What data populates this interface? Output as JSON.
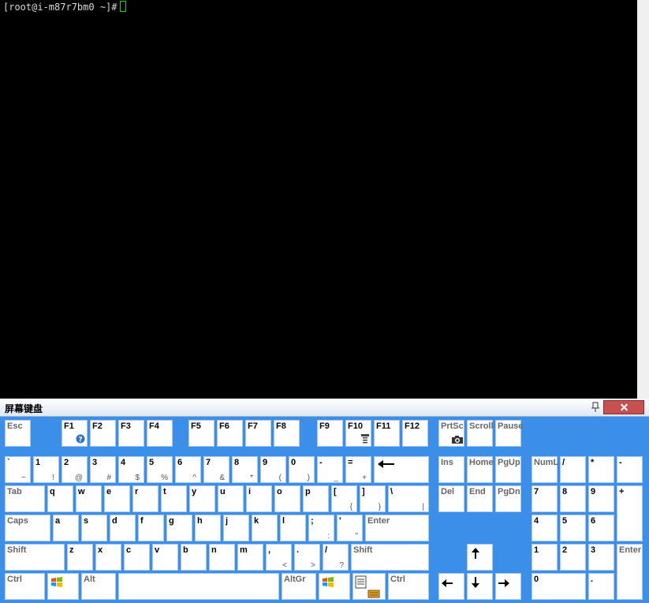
{
  "terminal": {
    "prompt": "[root@i-m87r7bm0 ~]#"
  },
  "osk": {
    "title": "屏幕键盘",
    "icons": {
      "pin": "pin-icon",
      "close": "close-icon"
    },
    "keys": [
      {
        "n": "esc",
        "p": "Esc",
        "d": 1
      },
      {
        "n": "f1",
        "p": "F1",
        "icon": "help-icon"
      },
      {
        "n": "f2",
        "p": "F2"
      },
      {
        "n": "f3",
        "p": "F3"
      },
      {
        "n": "f4",
        "p": "F4"
      },
      {
        "n": "f5",
        "p": "F5"
      },
      {
        "n": "f6",
        "p": "F6"
      },
      {
        "n": "f7",
        "p": "F7"
      },
      {
        "n": "f8",
        "p": "F8"
      },
      {
        "n": "f9",
        "p": "F9"
      },
      {
        "n": "f10",
        "p": "F10",
        "icon": "menu-icon"
      },
      {
        "n": "f11",
        "p": "F11"
      },
      {
        "n": "f12",
        "p": "F12"
      },
      {
        "n": "prtsc",
        "p": "PrtSc",
        "icon": "camera-icon",
        "d": 1
      },
      {
        "n": "scroll",
        "p": "Scroll",
        "d": 1
      },
      {
        "n": "pause",
        "p": "Pause",
        "d": 1
      },
      {
        "n": "backtick",
        "p": "`",
        "s": "~"
      },
      {
        "n": "1",
        "p": "1",
        "s": "!"
      },
      {
        "n": "2",
        "p": "2",
        "s": "@"
      },
      {
        "n": "3",
        "p": "3",
        "s": "#"
      },
      {
        "n": "4",
        "p": "4",
        "s": "$"
      },
      {
        "n": "5",
        "p": "5",
        "s": "%"
      },
      {
        "n": "6",
        "p": "6",
        "s": "^"
      },
      {
        "n": "7",
        "p": "7",
        "s": "&"
      },
      {
        "n": "8",
        "p": "8",
        "s": "*"
      },
      {
        "n": "9",
        "p": "9",
        "s": "("
      },
      {
        "n": "0",
        "p": "0",
        "s": ")"
      },
      {
        "n": "minus",
        "p": "-",
        "s": "_"
      },
      {
        "n": "equals",
        "p": "=",
        "s": "+"
      },
      {
        "n": "backspace",
        "icon": "backspace-arrow-icon"
      },
      {
        "n": "ins",
        "p": "Ins",
        "d": 1
      },
      {
        "n": "home",
        "p": "Home",
        "d": 1
      },
      {
        "n": "pgup",
        "p": "PgUp",
        "d": 1
      },
      {
        "n": "numlock",
        "p": "NumL",
        "d": 1
      },
      {
        "n": "num-divide",
        "p": "/"
      },
      {
        "n": "num-multiply",
        "p": "*"
      },
      {
        "n": "num-minus",
        "p": "-"
      },
      {
        "n": "tab",
        "p": "Tab",
        "d": 1
      },
      {
        "n": "q",
        "p": "q"
      },
      {
        "n": "w",
        "p": "w"
      },
      {
        "n": "e",
        "p": "e"
      },
      {
        "n": "r",
        "p": "r"
      },
      {
        "n": "t",
        "p": "t"
      },
      {
        "n": "y",
        "p": "y"
      },
      {
        "n": "u",
        "p": "u"
      },
      {
        "n": "i",
        "p": "i"
      },
      {
        "n": "o",
        "p": "o"
      },
      {
        "n": "p",
        "p": "p"
      },
      {
        "n": "lbracket",
        "p": "[",
        "s": "{"
      },
      {
        "n": "rbracket",
        "p": "]",
        "s": "}"
      },
      {
        "n": "backslash",
        "p": "\\",
        "s": "|"
      },
      {
        "n": "del",
        "p": "Del",
        "d": 1
      },
      {
        "n": "end",
        "p": "End",
        "d": 1
      },
      {
        "n": "pgdn",
        "p": "PgDn",
        "d": 1
      },
      {
        "n": "num7",
        "p": "7"
      },
      {
        "n": "num8",
        "p": "8"
      },
      {
        "n": "num9",
        "p": "9"
      },
      {
        "n": "num-plus",
        "p": "+"
      },
      {
        "n": "caps",
        "p": "Caps",
        "d": 1
      },
      {
        "n": "a",
        "p": "a"
      },
      {
        "n": "s",
        "p": "s"
      },
      {
        "n": "d",
        "p": "d"
      },
      {
        "n": "f",
        "p": "f"
      },
      {
        "n": "g",
        "p": "g"
      },
      {
        "n": "h",
        "p": "h"
      },
      {
        "n": "j",
        "p": "j"
      },
      {
        "n": "k",
        "p": "k"
      },
      {
        "n": "l",
        "p": "l"
      },
      {
        "n": "semicolon",
        "p": ";",
        "s": ":"
      },
      {
        "n": "quote",
        "p": "'",
        "s": "\""
      },
      {
        "n": "enter",
        "p": "Enter",
        "d": 1
      },
      {
        "n": "num4",
        "p": "4"
      },
      {
        "n": "num5",
        "p": "5"
      },
      {
        "n": "num6",
        "p": "6"
      },
      {
        "n": "lshift",
        "p": "Shift",
        "d": 1
      },
      {
        "n": "z",
        "p": "z"
      },
      {
        "n": "x",
        "p": "x"
      },
      {
        "n": "c",
        "p": "c"
      },
      {
        "n": "v",
        "p": "v"
      },
      {
        "n": "b",
        "p": "b"
      },
      {
        "n": "n",
        "p": "n"
      },
      {
        "n": "m",
        "p": "m"
      },
      {
        "n": "comma",
        "p": ",",
        "s": "<"
      },
      {
        "n": "period",
        "p": ".",
        "s": ">"
      },
      {
        "n": "slash",
        "p": "/",
        "s": "?"
      },
      {
        "n": "rshift",
        "p": "Shift",
        "d": 1
      },
      {
        "n": "up",
        "icon": "arrow-up-icon"
      },
      {
        "n": "num1",
        "p": "1"
      },
      {
        "n": "num2",
        "p": "2"
      },
      {
        "n": "num3",
        "p": "3"
      },
      {
        "n": "num-enter",
        "p": "Enter",
        "d": 1
      },
      {
        "n": "lctrl",
        "p": "Ctrl",
        "d": 1
      },
      {
        "n": "lwin",
        "icon": "windows-logo-icon"
      },
      {
        "n": "alt",
        "p": "Alt",
        "d": 1
      },
      {
        "n": "space"
      },
      {
        "n": "altgr",
        "p": "AltGr",
        "d": 1
      },
      {
        "n": "rwin",
        "icon": "windows-logo-icon"
      },
      {
        "n": "menu",
        "icon": "context-menu-icon"
      },
      {
        "n": "rctrl",
        "p": "Ctrl",
        "d": 1
      },
      {
        "n": "left",
        "icon": "arrow-left-icon"
      },
      {
        "n": "down",
        "icon": "arrow-down-icon"
      },
      {
        "n": "right",
        "icon": "arrow-right-icon"
      },
      {
        "n": "num0",
        "p": "0"
      },
      {
        "n": "num-decimal",
        "p": "."
      }
    ]
  }
}
